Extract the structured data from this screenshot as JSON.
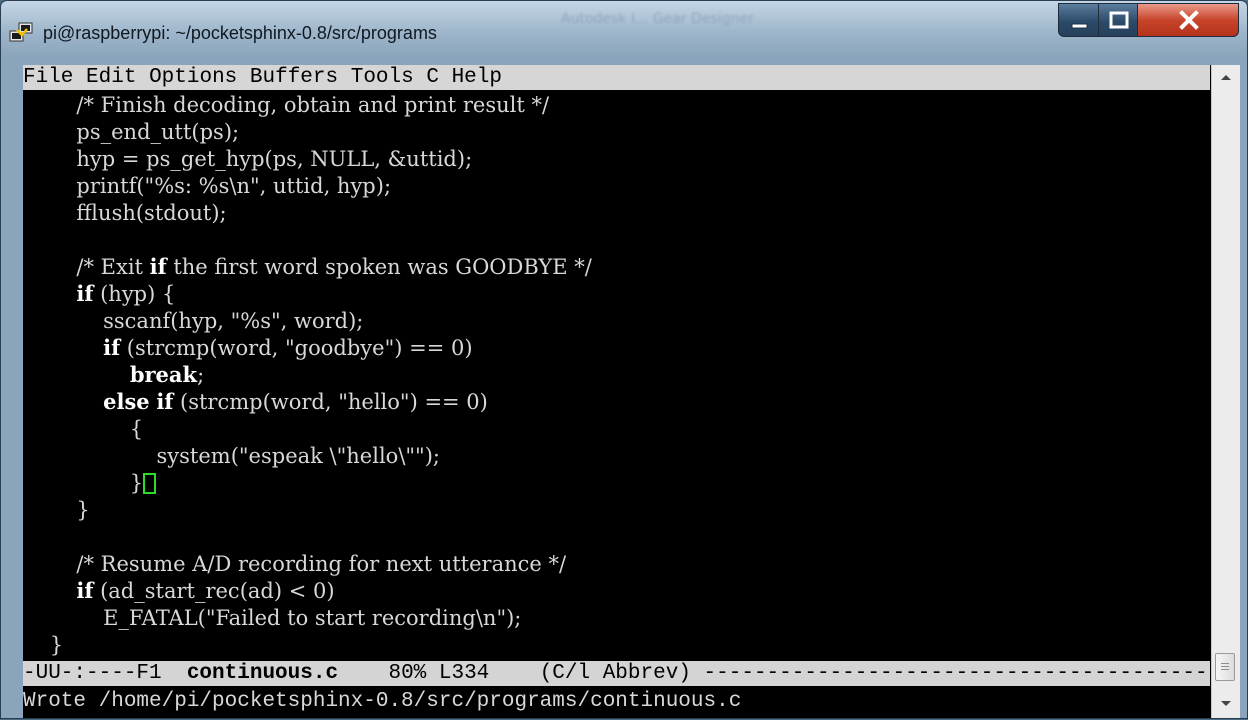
{
  "window": {
    "title": "pi@raspberrypi: ~/pocketsphinx-0.8/src/programs",
    "background_title": "Autodesk I... Gear Designer"
  },
  "menubar": {
    "items": [
      "File",
      "Edit",
      "Options",
      "Buffers",
      "Tools",
      "C",
      "Help"
    ]
  },
  "code": {
    "lines": [
      "        /* Finish decoding, obtain and print result */",
      "        ps_end_utt(ps);",
      "        hyp = ps_get_hyp(ps, NULL, &uttid);",
      "        printf(\"%s: %s\\n\", uttid, hyp);",
      "        fflush(stdout);",
      "",
      "        /* Exit if the first word spoken was GOODBYE */",
      "        if (hyp) {",
      "            sscanf(hyp, \"%s\", word);",
      "            if (strcmp(word, \"goodbye\") == 0)",
      "                break;",
      "            else if (strcmp(word, \"hello\") == 0)",
      "                {",
      "                    system(\"espeak \\\"hello\\\"\");",
      "                }",
      "        }",
      "",
      "        /* Resume A/D recording for next utterance */",
      "        if (ad_start_rec(ad) < 0)",
      "            E_FATAL(\"Failed to start recording\\n\");",
      "    }"
    ]
  },
  "modeline": {
    "prefix": "-UU-:----F1  ",
    "buffer_name": "continuous.c",
    "position": "    80% L334    (C/l Abbrev) ",
    "fill": "--------------------------------------------------"
  },
  "echo_area": {
    "message": "Wrote /home/pi/pocketsphinx-0.8/src/programs/continuous.c"
  },
  "colors": {
    "terminal_bg": "#000000",
    "terminal_fg": "#d8d8d8",
    "menubar_bg": "#d6d6d6",
    "cursor": "#2edc2e",
    "close_button": "#c8452c"
  },
  "icons": [
    "putty-terminal-icon",
    "minimize-icon",
    "maximize-icon",
    "close-icon",
    "scroll-up-arrow-icon",
    "scroll-down-arrow-icon"
  ]
}
